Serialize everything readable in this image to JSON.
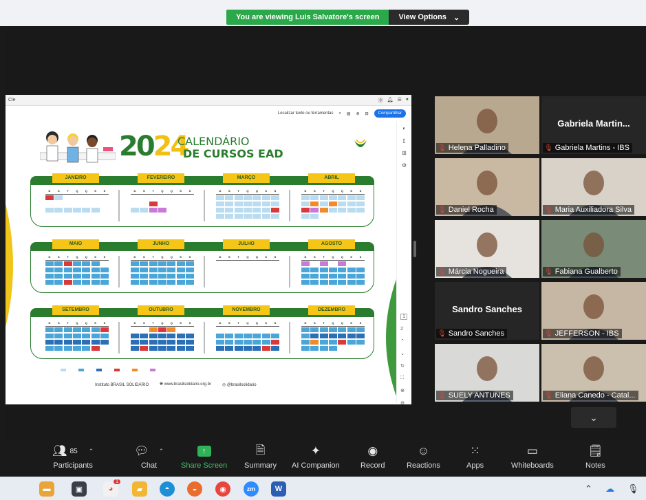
{
  "banner": {
    "message": "You are viewing Luis Salvatore's screen",
    "button": "View Options",
    "caret": "⌄"
  },
  "shared_doc": {
    "top_left": "Cle",
    "toolbar_search": "Localizar texto ou ferramentas",
    "share_button": "Compartilhar",
    "year_a": "20",
    "year_b": "24",
    "title_line1": "CALENDÁRIO",
    "title_line2": "DE CURSOS EAD",
    "weekdays": [
      "D",
      "S",
      "T",
      "Q",
      "Q",
      "S",
      "S"
    ],
    "months": [
      "JANEIRO",
      "FEVEREIRO",
      "MARÇO",
      "ABRIL",
      "MAIO",
      "JUNHO",
      "JULHO",
      "AGOSTO",
      "SETEMBRO",
      "OUTUBRO",
      "NOVEMBRO",
      "DEZEMBRO"
    ],
    "footer_org": "Instituto BRASIL SOLIDÁRIO",
    "footer_site": "www.brasilsolidario.org.br",
    "footer_social": "@brasilsolidario",
    "pager_page": "1",
    "pager_total": "2"
  },
  "participants": [
    {
      "name": "Helena Palladino",
      "video": true,
      "bg": "#b8a890"
    },
    {
      "name": "Gabriela Martins - IBS",
      "display": "Gabriela  Martin...",
      "video": false
    },
    {
      "name": "Daniel Rocha",
      "video": true,
      "bg": "#c9b9a2"
    },
    {
      "name": "Maria Auxiliadora Silva",
      "video": true,
      "bg": "#d8d2c8"
    },
    {
      "name": "Márcia Nogueira",
      "video": true,
      "bg": "#e6e3de"
    },
    {
      "name": "Fabiana Gualberto",
      "video": true,
      "bg": "#7a8c78"
    },
    {
      "name": "Sandro Sanches",
      "display": "Sandro Sanches",
      "video": false
    },
    {
      "name": "JEFFERSON - IBS",
      "video": true,
      "bg": "#c6b7a4"
    },
    {
      "name": "SUELY ANTUNES",
      "video": true,
      "bg": "#d9d9d7"
    },
    {
      "name": "Eliana Canedo - Catal...",
      "video": true,
      "bg": "#cbbfae"
    }
  ],
  "toolbar": {
    "participants": {
      "label": "Participants",
      "count": "85"
    },
    "chat": "Chat",
    "share": "Share Screen",
    "summary": "Summary",
    "companion": "AI Companion",
    "record": "Record",
    "reactions": "Reactions",
    "apps": "Apps",
    "whiteboards": "Whiteboards",
    "notes": "Notes"
  },
  "taskbar": {
    "zoom_label": "zm",
    "word_label": "W",
    "notif_count": "1"
  }
}
